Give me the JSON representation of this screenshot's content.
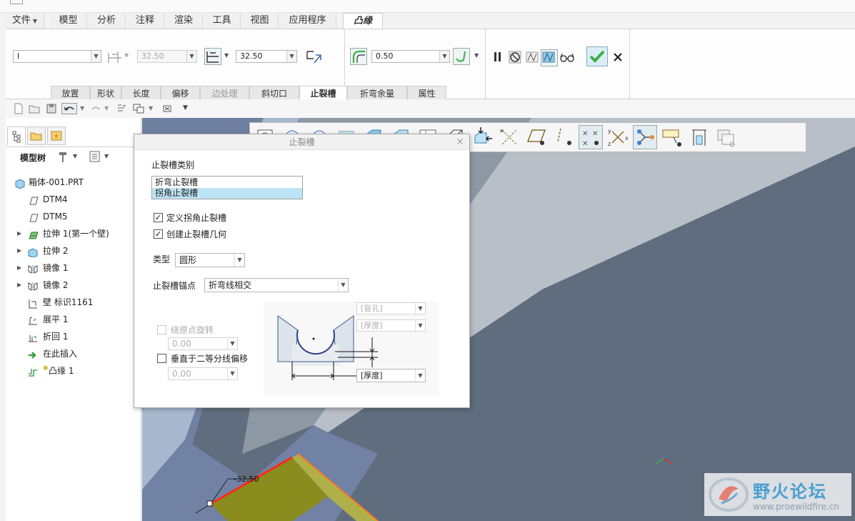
{
  "menu": {
    "tabs": [
      {
        "label": "文件"
      },
      {
        "label": "模型"
      },
      {
        "label": "分析"
      },
      {
        "label": "注释"
      },
      {
        "label": "渲染"
      },
      {
        "label": "工具"
      },
      {
        "label": "视图"
      },
      {
        "label": "应用程序"
      },
      {
        "label": "凸缘"
      }
    ],
    "active_tab": "凸缘"
  },
  "ribbon": {
    "shape_value": "I",
    "length1_value": "32.50",
    "length2_value": "32.50",
    "radius_value": "0.50",
    "subtabs": [
      {
        "label": "放置"
      },
      {
        "label": "形状"
      },
      {
        "label": "长度"
      },
      {
        "label": "偏移"
      },
      {
        "label": "边处理"
      },
      {
        "label": "斜切口"
      },
      {
        "label": "止裂槽"
      },
      {
        "label": "折弯余量"
      },
      {
        "label": "属性"
      }
    ],
    "active_subtab": "止裂槽"
  },
  "model_tree": {
    "label": "模型树",
    "items": [
      {
        "label": "箱体-001.PRT",
        "icon": "part-icon",
        "expandable": false
      },
      {
        "label": "DTM4",
        "icon": "datum-plane-icon",
        "expandable": false
      },
      {
        "label": "DTM5",
        "icon": "datum-plane-icon",
        "expandable": false
      },
      {
        "label": "拉伸 1(第一个壁)",
        "icon": "extrude-wall-icon",
        "expandable": true
      },
      {
        "label": "拉伸 2",
        "icon": "extrude-icon",
        "expandable": true
      },
      {
        "label": "镜像 1",
        "icon": "mirror-icon",
        "expandable": true
      },
      {
        "label": "镜像 2",
        "icon": "mirror-icon",
        "expandable": true
      },
      {
        "label": "壁 标识1161",
        "icon": "wall-icon",
        "expandable": false
      },
      {
        "label": "展平 1",
        "icon": "unbend-icon",
        "expandable": false
      },
      {
        "label": "折回 1",
        "icon": "bendback-icon",
        "expandable": false
      },
      {
        "label": "在此插入",
        "icon": "insert-here-arrow-icon",
        "expandable": false
      },
      {
        "label": "凸缘 1",
        "icon": "flange-icon",
        "expandable": false
      }
    ]
  },
  "dialog": {
    "title": "止裂槽",
    "relief_category_label": "止裂槽类别",
    "relief_categories": [
      "折弯止裂槽",
      "拐角止裂槽"
    ],
    "selected_category": "拐角止裂槽",
    "define_corner_relief": {
      "label": "定义拐角止裂槽",
      "checked": true
    },
    "create_relief_geometry": {
      "label": "创建止裂槽几何",
      "checked": true
    },
    "type_label": "类型",
    "type_value": "圆形",
    "anchor_label": "止裂槽锚点",
    "anchor_value": "折弯线相交",
    "rotate_origin": {
      "label": "绕原点旋转",
      "checked": false,
      "value": "0.00"
    },
    "offset_bisector": {
      "label": "垂直于二等分线偏移",
      "checked": false,
      "value": "0.00"
    },
    "diagram_fields": [
      "[盲孔]",
      "[厚度]",
      "[厚度]"
    ]
  },
  "viewport": {
    "dimension_label": "-32.50"
  },
  "watermark": {
    "title": "野火论坛",
    "url": "www.proewildfire.cn"
  },
  "colors": {
    "accent_green": "#3fae49",
    "viewport_bg": "#5d6a7a",
    "selection_blue": "#bde4f5",
    "flange_yellow": "#8a8c1e",
    "edge_red": "#ff2a1a"
  }
}
